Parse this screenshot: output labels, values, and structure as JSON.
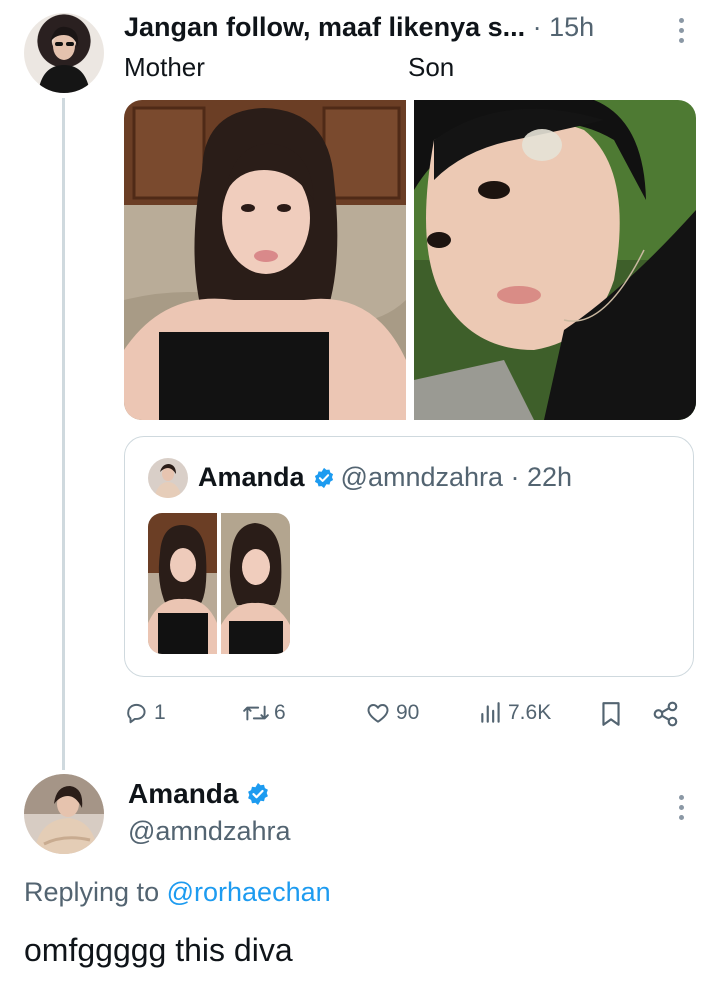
{
  "tweet": {
    "author_name": "Jangan follow, maaf likenya s...",
    "time": "· 15h",
    "caption_left": "Mother",
    "caption_right": "Son",
    "quote": {
      "name": "Amanda",
      "handle": "@amndzahra · 22h"
    },
    "actions": {
      "replies": "1",
      "retweets": "6",
      "likes": "90",
      "views": "7.6K"
    }
  },
  "reply": {
    "name": "Amanda",
    "handle": "@amndzahra",
    "replying_prefix": "Replying to",
    "replying_mention": "@rorhaechan",
    "text": "omfggggg this diva"
  },
  "icons": {
    "reply": "speech-bubble-icon",
    "retweet": "retweet-icon",
    "like": "heart-icon",
    "views": "bar-chart-icon",
    "bookmark": "bookmark-icon",
    "share": "share-icon",
    "verified": "verified-badge-icon",
    "more": "more-vertical-icon"
  },
  "colors": {
    "accent": "#1d9bf0",
    "secondary_text": "#536471",
    "border": "#cfd9de"
  }
}
